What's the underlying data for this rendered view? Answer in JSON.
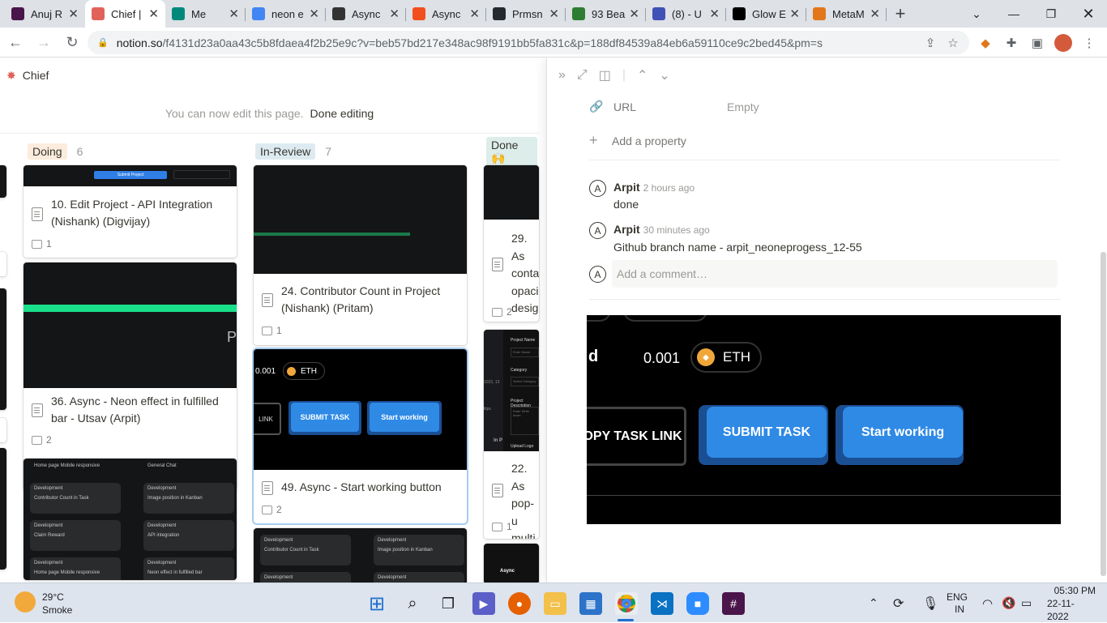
{
  "browser": {
    "tabs": [
      {
        "title": "Anuj R",
        "favicon": "slack-icon",
        "color": "#4a154b"
      },
      {
        "title": "Chief |",
        "favicon": "notion-chief-icon",
        "color": "#e16259"
      },
      {
        "title": "Me",
        "favicon": "meet-icon",
        "color": "#00897b"
      },
      {
        "title": "neon e",
        "favicon": "google-icon",
        "color": "#4285f4"
      },
      {
        "title": "Async",
        "favicon": "async-icon",
        "color": "#333"
      },
      {
        "title": "Async",
        "favicon": "figma-icon",
        "color": "#f24e1e"
      },
      {
        "title": "Prmsn",
        "favicon": "github-icon",
        "color": "#24292f"
      },
      {
        "title": "93 Bea",
        "favicon": "dapp-icon",
        "color": "#2e7d32"
      },
      {
        "title": "(8) - U",
        "favicon": "cloud-icon",
        "color": "#3f51b5"
      },
      {
        "title": "Glow E",
        "favicon": "glow-icon",
        "color": "#000"
      },
      {
        "title": "MetaM",
        "favicon": "metamask-icon",
        "color": "#e2761b"
      }
    ],
    "url_domain": "notion.so",
    "url_path": "/f4131d23a0aa43c5b8fdaea4f2b25e9c?v=beb57bd217e348ac98f9191bb5fa831c&p=188df84539a84eb6a59110ce9c2bed45&pm=s"
  },
  "page": {
    "title": "Chief",
    "edit_notice": "You can now edit this page.",
    "done_editing": "Done editing"
  },
  "board": {
    "columns": [
      {
        "name": "Doing",
        "count": "6",
        "bg": "#fbecdd"
      },
      {
        "name": "In-Review",
        "count": "7",
        "bg": "#ddebf1"
      },
      {
        "name": "Done 🙌",
        "count": "",
        "bg": "#ddedea"
      }
    ],
    "doing_cards": [
      {
        "title": "10. Edit Project - API Integration (Nishank) (Digvijay)",
        "comments": "1"
      },
      {
        "title": "36. Async - Neon effect in fulfilled bar - Utsav (Arpit)",
        "comments": "2"
      }
    ],
    "review_cards": [
      {
        "title": "24. Contributor Count in Project (Nishank) (Pritam)",
        "comments": "1"
      },
      {
        "title": "49. Async - Start working button",
        "comments": "2"
      }
    ],
    "done_cards": [
      {
        "title": "29. As conta opaci desig",
        "comments": "2"
      },
      {
        "title": "22. As pop-u multi",
        "comments": "1"
      }
    ],
    "mini_tiles": [
      {
        "h": "Home page Mobile responsive",
        "s": ""
      },
      {
        "h": "General Chat",
        "s": ""
      },
      {
        "h": "Development",
        "s": "Contributor Count in Task"
      },
      {
        "h": "Development",
        "s": "Image position in Kanban"
      },
      {
        "h": "Development",
        "s": "Claim Reward"
      },
      {
        "h": "Development",
        "s": "API integration"
      },
      {
        "h": "Development",
        "s": "Home page Mobile responsive"
      },
      {
        "h": "Development",
        "s": "Neon effect in fulfilled bar"
      }
    ],
    "review_tiles": [
      {
        "h": "Development",
        "s": "Contributor Count in Task"
      },
      {
        "h": "Development",
        "s": "Image position in Kanban"
      },
      {
        "h": "Development",
        "s": ""
      },
      {
        "h": "Development",
        "s": ""
      }
    ],
    "form_labels": {
      "name": "Project Name",
      "name_ph": "Enter Name",
      "category": "Category",
      "cat_ph": "Select Category",
      "desc": "Project Description",
      "desc_ph": "Enter Write down",
      "upload": "Upload Logo",
      "in": "In P",
      "tips": "ltips",
      "date": "1022, 13"
    },
    "async_brand": "Async",
    "cover_text": "P",
    "submit_small": "Submit Project"
  },
  "panel": {
    "property_label": "URL",
    "property_value": "Empty",
    "add_property": "Add a property",
    "comments": [
      {
        "author": "Arpit",
        "time": "2 hours ago",
        "text": "done",
        "avatar": "A"
      },
      {
        "author": "Arpit",
        "time": "30 minutes ago",
        "text": "Github branch name - arpit_neoneprogess_12-55",
        "avatar": "A"
      }
    ],
    "add_comment_placeholder": "Add a comment…",
    "add_comment_avatar": "A",
    "preview": {
      "eth_amount": "0.001",
      "eth_label": "ETH",
      "copy_link": "OPY TASK LINK",
      "submit": "SUBMIT TASK",
      "start": "Start working",
      "left_letter": "d",
      "small_copy": "LINK"
    }
  },
  "taskbar": {
    "weather_temp": "29°C",
    "weather_desc": "Smoke",
    "lang": "ENG",
    "region": "IN",
    "time": "05:30 PM",
    "date": "22-11-2022"
  }
}
